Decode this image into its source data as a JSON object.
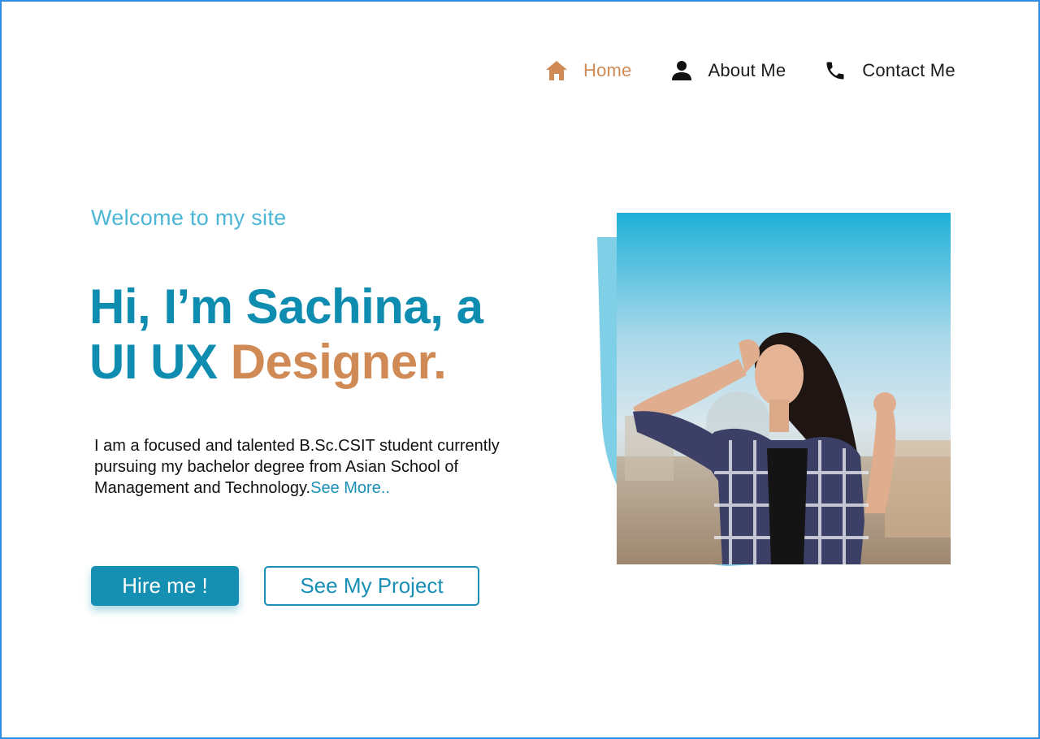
{
  "nav": {
    "items": [
      {
        "label": "Home",
        "icon": "home-icon",
        "active": true
      },
      {
        "label": "About Me",
        "icon": "person-icon",
        "active": false
      },
      {
        "label": "Contact Me",
        "icon": "phone-icon",
        "active": false
      }
    ]
  },
  "hero": {
    "welcome": "Welcome to my site",
    "headline_line1": "Hi, I’m Sachina, a",
    "headline_line2_part1": "UI UX ",
    "headline_line2_accent": "Designer.",
    "bio": "I am a focused and talented B.Sc.CSIT student currently pursuing my bachelor degree from Asian School of Management and Technology.",
    "see_more": "See More..",
    "hire_button": "Hire me !",
    "project_button": "See My Project"
  },
  "colors": {
    "primary": "#1590b2",
    "accent": "#d08a55",
    "light_blue": "#4bb6d6",
    "backdrop": "#7fcfe6",
    "frame_border": "#2e8fe6"
  }
}
